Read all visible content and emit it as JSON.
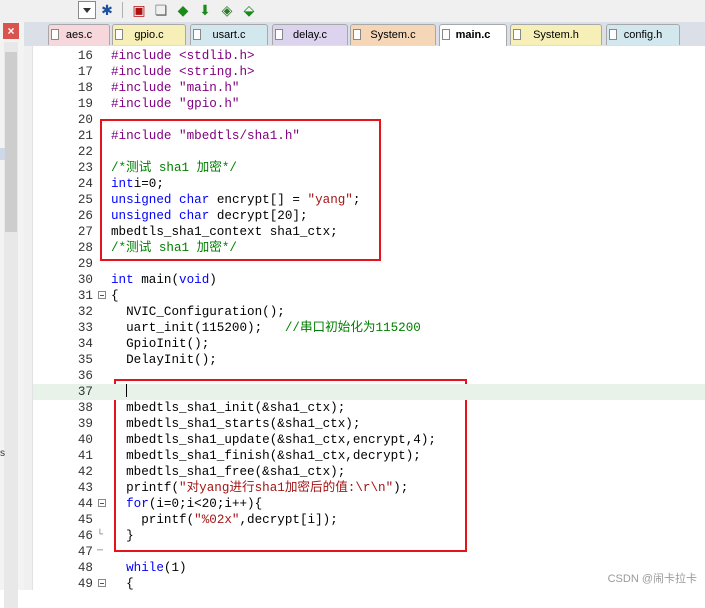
{
  "tabs": [
    {
      "label": "aes.c",
      "color": "#f5d7dc"
    },
    {
      "label": "gpio.c",
      "color": "#f6f0b8"
    },
    {
      "label": "usart.c",
      "color": "#d2e8ee"
    },
    {
      "label": "delay.c",
      "color": "#dcd3ee"
    },
    {
      "label": "System.c",
      "color": "#f5d7b8"
    },
    {
      "label": "main.c",
      "color": "#ffffff",
      "active": true
    },
    {
      "label": "System.h",
      "color": "#f6f0b8"
    },
    {
      "label": "config.h",
      "color": "#d2e8ee"
    }
  ],
  "lines": [
    {
      "n": "16",
      "html": "#include <stdlib.h>",
      "kind": "pp"
    },
    {
      "n": "17",
      "html": "#include <string.h>",
      "kind": "pp"
    },
    {
      "n": "18",
      "html": "#include \"main.h\"",
      "kind": "pp"
    },
    {
      "n": "19",
      "html": "#include \"gpio.h\"",
      "kind": "pp"
    },
    {
      "n": "20",
      "html": ""
    },
    {
      "n": "21",
      "html": "#include \"mbedtls/sha1.h\"",
      "kind": "pp"
    },
    {
      "n": "22",
      "html": ""
    },
    {
      "n": "23",
      "html": "/*测试 sha1 加密*/",
      "kind": "cm"
    },
    {
      "n": "24",
      "parts": [
        [
          "kw",
          "int"
        ],
        [
          "",
          "i=0;"
        ]
      ]
    },
    {
      "n": "25",
      "parts": [
        [
          "kw",
          "unsigned"
        ],
        [
          "",
          " "
        ],
        [
          "kw",
          "char"
        ],
        [
          "",
          " encrypt[] = "
        ],
        [
          "str",
          "\"yang\""
        ],
        [
          "",
          ";"
        ]
      ]
    },
    {
      "n": "26",
      "parts": [
        [
          "kw",
          "unsigned"
        ],
        [
          "",
          " "
        ],
        [
          "kw",
          "char"
        ],
        [
          "",
          " decrypt[20];"
        ]
      ]
    },
    {
      "n": "27",
      "html": "mbedtls_sha1_context sha1_ctx;"
    },
    {
      "n": "28",
      "html": "/*测试 sha1 加密*/",
      "kind": "cm"
    },
    {
      "n": "29",
      "html": ""
    },
    {
      "n": "30",
      "parts": [
        [
          "kw",
          "int"
        ],
        [
          "",
          " main("
        ],
        [
          "kw",
          "void"
        ],
        [
          "",
          ")"
        ]
      ]
    },
    {
      "n": "31",
      "html": "{",
      "fold": "box"
    },
    {
      "n": "32",
      "html": "  NVIC_Configuration();"
    },
    {
      "n": "33",
      "parts": [
        [
          "",
          "  uart_init(115200);   "
        ],
        [
          "cm",
          "//串口初始化为115200"
        ]
      ]
    },
    {
      "n": "34",
      "html": "  GpioInit();"
    },
    {
      "n": "35",
      "html": "  DelayInit();"
    },
    {
      "n": "36",
      "html": ""
    },
    {
      "n": "37",
      "html": "  ",
      "current": true
    },
    {
      "n": "38",
      "html": "  mbedtls_sha1_init(&sha1_ctx);"
    },
    {
      "n": "39",
      "html": "  mbedtls_sha1_starts(&sha1_ctx);"
    },
    {
      "n": "40",
      "html": "  mbedtls_sha1_update(&sha1_ctx,encrypt,4);"
    },
    {
      "n": "41",
      "html": "  mbedtls_sha1_finish(&sha1_ctx,decrypt);"
    },
    {
      "n": "42",
      "html": "  mbedtls_sha1_free(&sha1_ctx);"
    },
    {
      "n": "43",
      "parts": [
        [
          "",
          "  printf("
        ],
        [
          "str",
          "\"对yang进行sha1加密后的值:\\r\\n\""
        ],
        [
          "",
          ");"
        ]
      ]
    },
    {
      "n": "44",
      "parts": [
        [
          "",
          "  "
        ],
        [
          "kw",
          "for"
        ],
        [
          "",
          "(i=0;i<20;i++){"
        ]
      ],
      "fold": "box"
    },
    {
      "n": "45",
      "parts": [
        [
          "",
          "    printf("
        ],
        [
          "str",
          "\"%02x\""
        ],
        [
          "",
          ",decrypt[i]);"
        ]
      ]
    },
    {
      "n": "46",
      "html": "  }",
      "fold": "end"
    },
    {
      "n": "47",
      "html": "",
      "fold": "dash"
    },
    {
      "n": "48",
      "parts": [
        [
          "",
          "  "
        ],
        [
          "kw",
          "while"
        ],
        [
          "",
          "(1)"
        ]
      ]
    },
    {
      "n": "49",
      "html": "  {",
      "fold": "box"
    }
  ],
  "watermark": "CSDN @闹卡拉卡",
  "panel_letter": "s"
}
